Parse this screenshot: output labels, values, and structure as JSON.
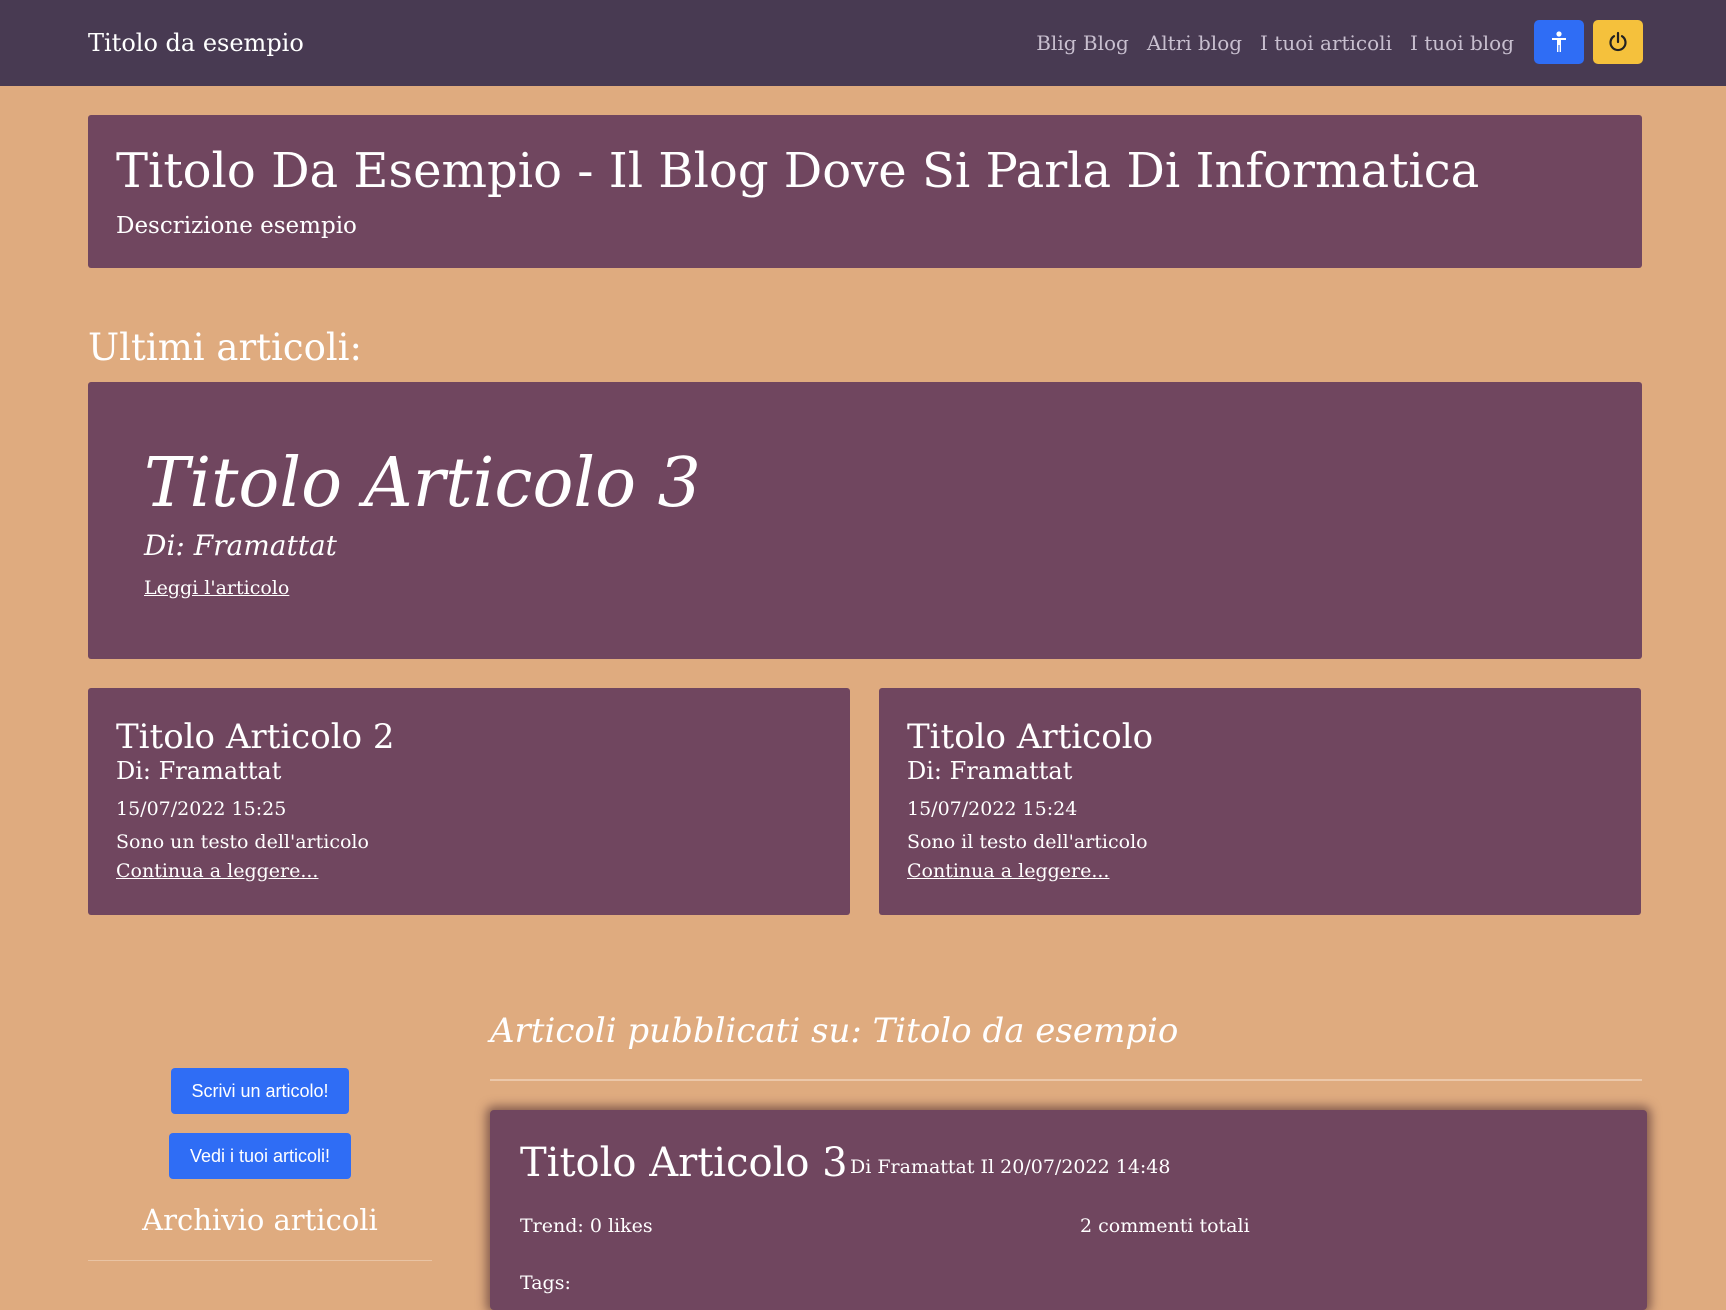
{
  "navbar": {
    "brand": "Titolo da esempio",
    "links": [
      "Blig Blog",
      "Altri blog",
      "I tuoi articoli",
      "I tuoi blog"
    ],
    "accessibility_icon": "person-accessibility-icon",
    "power_icon": "power-icon",
    "colors": {
      "background": "#483a52",
      "accessibility_button": "#2f6df5",
      "power_button": "#f5c13c"
    }
  },
  "hero": {
    "title": "Titolo Da Esempio - Il Blog Dove Si Parla Di Informatica",
    "description": "Descrizione esempio"
  },
  "latest": {
    "heading": "Ultimi articoli:",
    "featured": {
      "title": "Titolo Articolo 3",
      "author": "Di: Framattat",
      "link": "Leggi l'articolo"
    },
    "cards": [
      {
        "title": "Titolo Articolo 2",
        "author": "Di: Framattat",
        "date": "15/07/2022 15:25",
        "text": "Sono un testo dell'articolo",
        "link": "Continua a leggere..."
      },
      {
        "title": "Titolo Articolo",
        "author": "Di: Framattat",
        "date": "15/07/2022 15:24",
        "text": "Sono il testo dell'articolo",
        "link": "Continua a leggere..."
      }
    ]
  },
  "sidebar": {
    "write_button": "Scrivi un articolo!",
    "my_articles_button": "Vedi i tuoi articoli!",
    "archive_title": "Archivio articoli"
  },
  "published": {
    "heading": "Articoli pubblicati su: Titolo da esempio",
    "post": {
      "title": "Titolo Articolo 3",
      "meta": "Di Framattat Il 20/07/2022 14:48",
      "trend": "Trend: 0 likes",
      "comments": "2 commenti totali",
      "tags": "Tags:"
    }
  },
  "colors": {
    "page_background": "#dfab7f",
    "card_background": "#70465f"
  }
}
